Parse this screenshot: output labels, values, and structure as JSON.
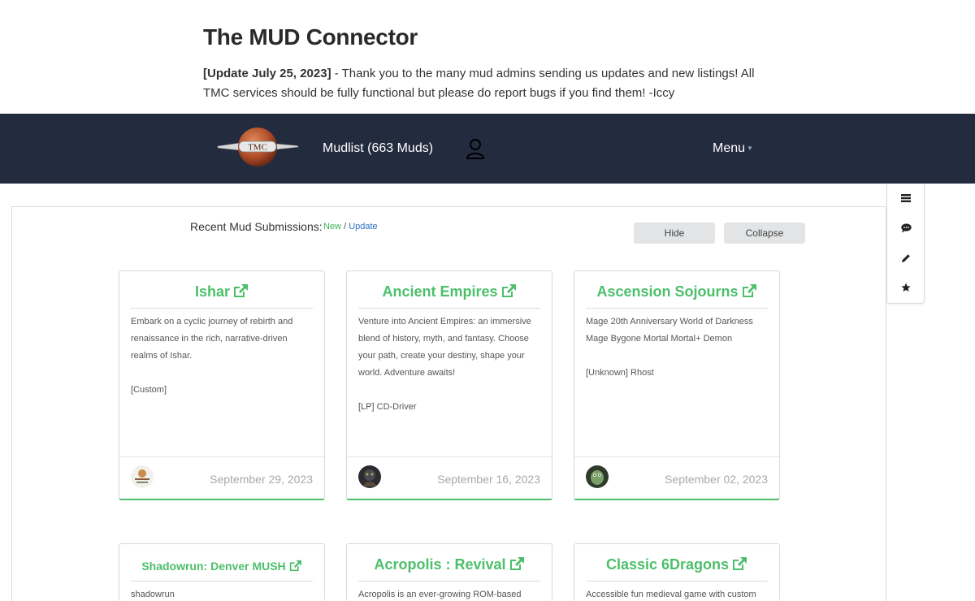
{
  "site": {
    "title": "The MUD Connector",
    "announcement_date": "[Update July 25, 2023]",
    "announcement_text": " - Thank you to the many mud admins sending us updates and new listings! All TMC services should be fully functional but please do report bugs if you find them! -Iccy"
  },
  "navbar": {
    "logo_text": "TMC",
    "mudlist_label": "Mudlist (663 Muds)",
    "menu_label": "Menu",
    "bg_color": "#232b3f"
  },
  "side_tools": [
    "list-icon",
    "comment-icon",
    "pencil-icon",
    "star-icon"
  ],
  "recent": {
    "label": "Recent Mud Submissions:",
    "new_link": "New",
    "separator": " / ",
    "update_link": "Update",
    "hide_button": "Hide",
    "collapse_button": "Collapse"
  },
  "accent_color": "#4cbf6a",
  "cards": [
    {
      "title": "Ishar",
      "description": "Embark on a cyclic journey of rebirth and renaissance in the rich, narrative-driven realms of Ishar.",
      "codebase": "[Custom]",
      "date": "September 29, 2023"
    },
    {
      "title": "Ancient Empires",
      "description": "Venture into Ancient Empires: an immersive blend of history, myth, and fantasy. Choose your path, create your destiny, shape your world. Adventure awaits!",
      "codebase": "[LP] CD-Driver",
      "date": "September 16, 2023"
    },
    {
      "title": "Ascension Sojourns",
      "description": "Mage 20th Anniversary World of Darkness Mage Bygone Mortal Mortal+ Demon",
      "codebase": "[Unknown] Rhost",
      "date": "September 02, 2023"
    },
    {
      "title": "Shadowrun: Denver MUSH",
      "description": "shadowrun"
    },
    {
      "title": "Acropolis : Revival",
      "description": "Acropolis is an ever-growing ROM-based"
    },
    {
      "title": "Classic 6Dragons",
      "description": "Accessible fun medieval game with custom"
    }
  ]
}
